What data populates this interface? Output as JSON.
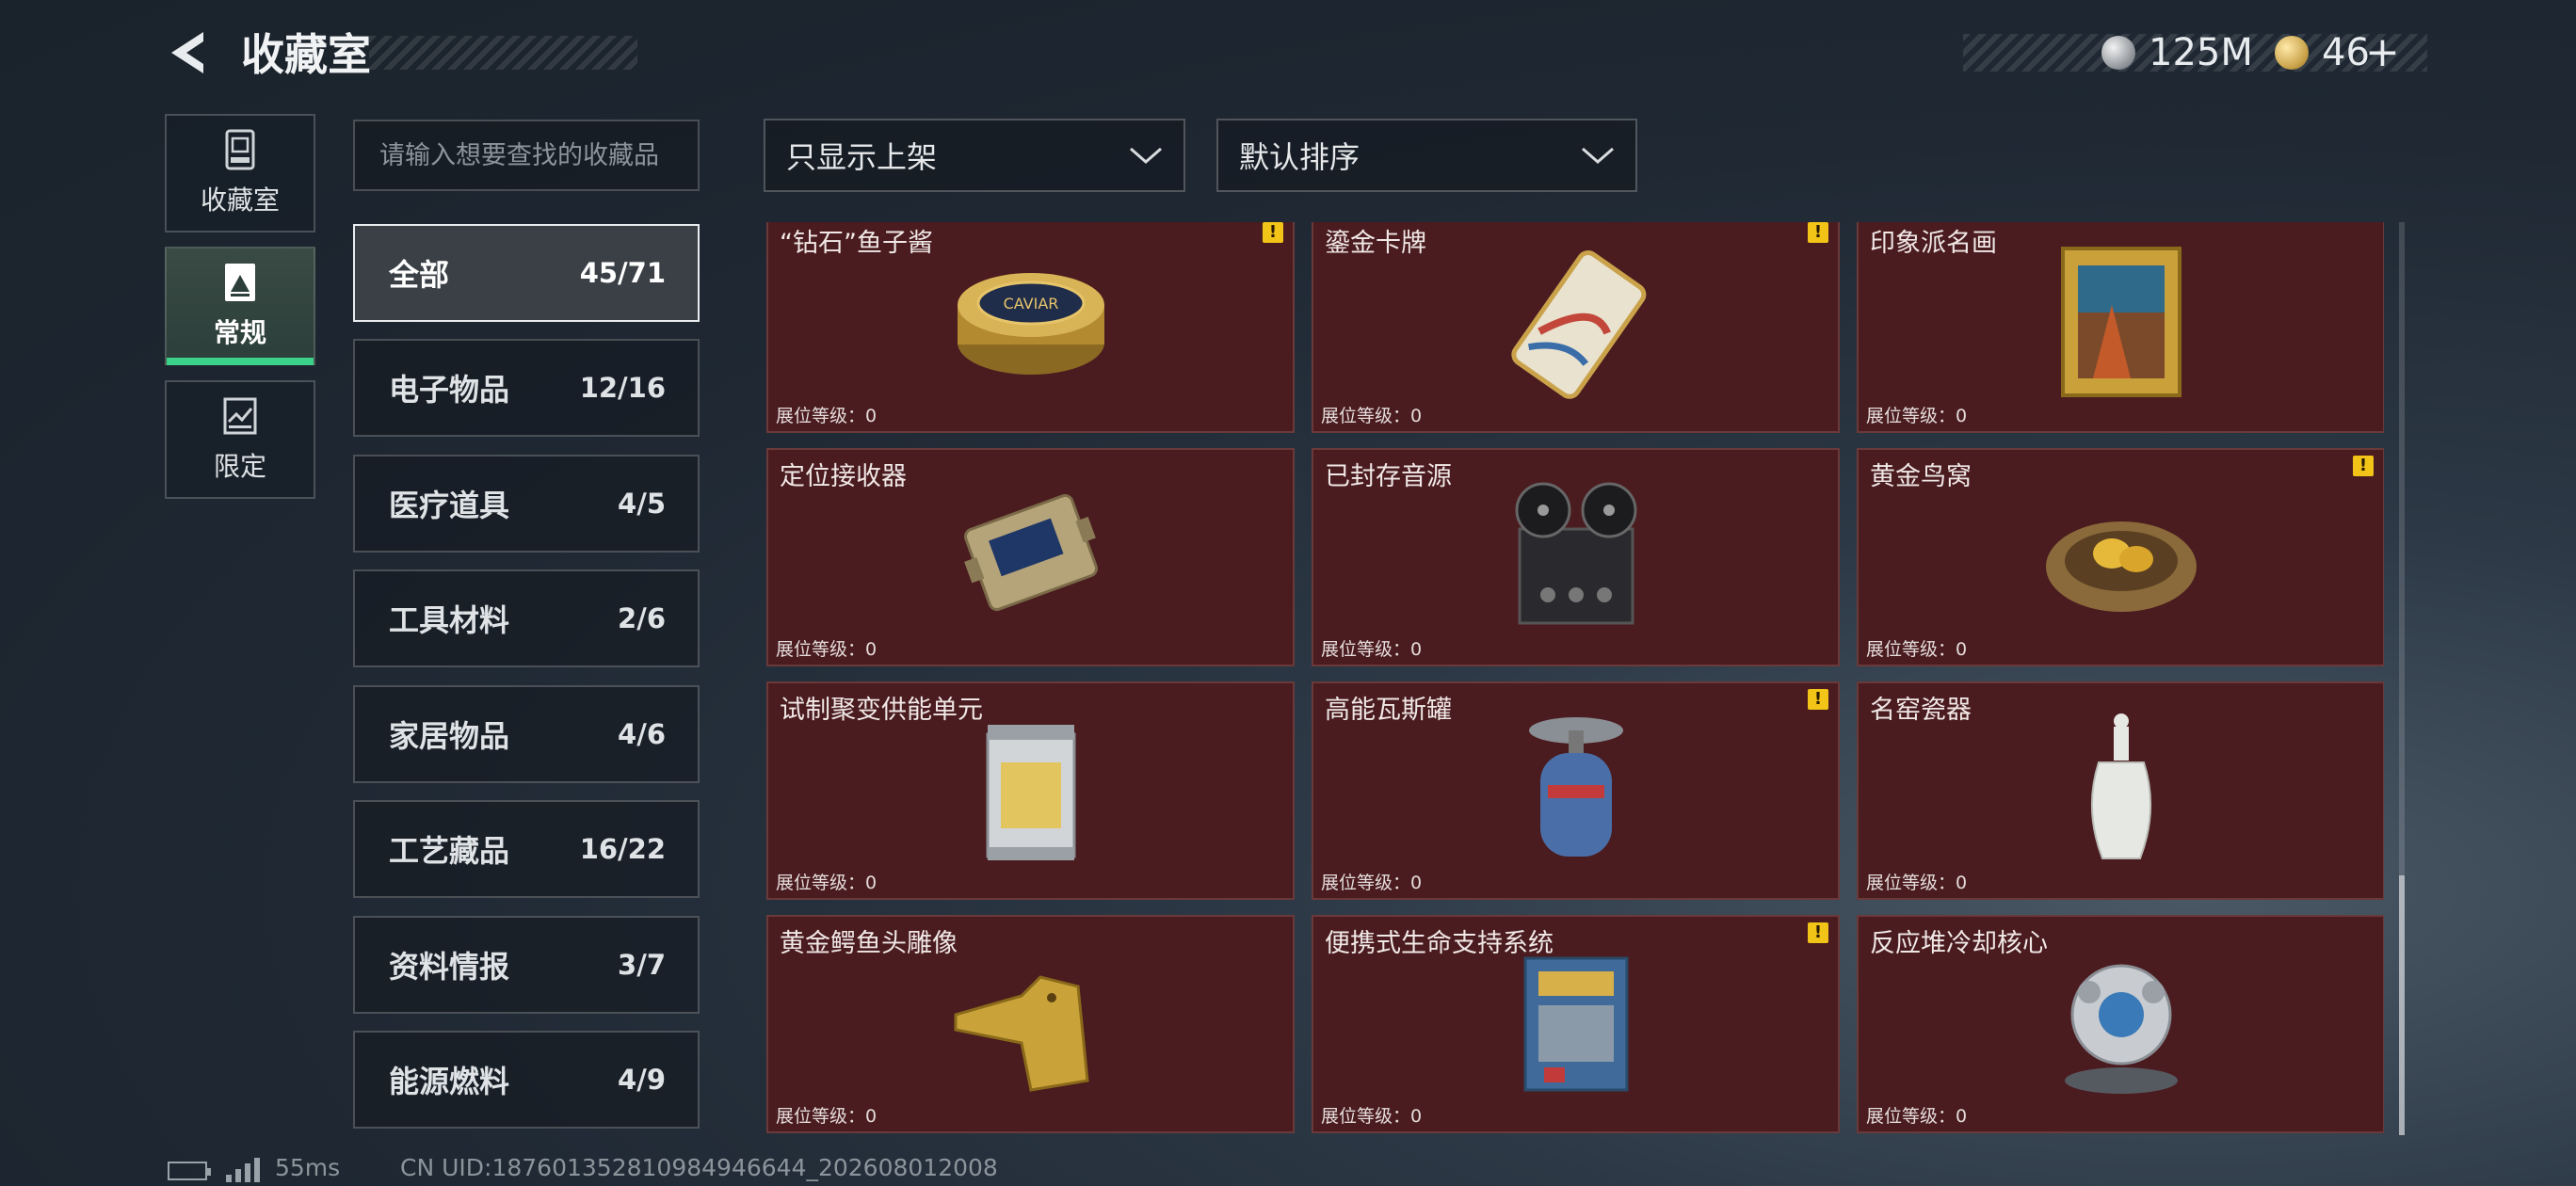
{
  "header": {
    "title": "收藏室",
    "currency_silver": "125M",
    "currency_gold": "46",
    "plus": "+"
  },
  "rail": [
    {
      "label": "收藏室",
      "icon": "vault-icon",
      "active": false
    },
    {
      "label": "常规",
      "icon": "picture-icon",
      "active": true
    },
    {
      "label": "限定",
      "icon": "limited-icon",
      "active": false
    }
  ],
  "search": {
    "placeholder": "请输入想要查找的收藏品"
  },
  "filters": {
    "display": "只显示上架",
    "sort": "默认排序"
  },
  "categories": [
    {
      "name": "全部",
      "count": "45/71"
    },
    {
      "name": "电子物品",
      "count": "12/16"
    },
    {
      "name": "医疗道具",
      "count": "4/5"
    },
    {
      "name": "工具材料",
      "count": "2/6"
    },
    {
      "name": "家居物品",
      "count": "4/6"
    },
    {
      "name": "工艺藏品",
      "count": "16/22"
    },
    {
      "name": "资料情报",
      "count": "3/7"
    },
    {
      "name": "能源燃料",
      "count": "4/9"
    }
  ],
  "items": [
    {
      "name": "“钻石”鱼子酱",
      "level": "展位等级：0",
      "warn": true
    },
    {
      "name": "鎏金卡牌",
      "level": "展位等级：0",
      "warn": true
    },
    {
      "name": "印象派名画",
      "level": "展位等级：0",
      "warn": false
    },
    {
      "name": "定位接收器",
      "level": "展位等级：0",
      "warn": false
    },
    {
      "name": "已封存音源",
      "level": "展位等级：0",
      "warn": false
    },
    {
      "name": "黄金鸟窝",
      "level": "展位等级：0",
      "warn": true
    },
    {
      "name": "试制聚变供能单元",
      "level": "展位等级：0",
      "warn": false
    },
    {
      "name": "高能瓦斯罐",
      "level": "展位等级：0",
      "warn": true
    },
    {
      "name": "名窑瓷器",
      "level": "展位等级：0",
      "warn": false
    },
    {
      "name": "黄金鳄鱼头雕像",
      "level": "展位等级：0",
      "warn": false
    },
    {
      "name": "便携式生命支持系统",
      "level": "展位等级：0",
      "warn": true
    },
    {
      "name": "反应堆冷却核心",
      "level": "展位等级：0",
      "warn": false
    }
  ],
  "warn_mark": "!",
  "caviar_label": "CAVIAR",
  "footer": {
    "ping": "55ms",
    "uid": "CN UID:187601352810984946644_202608012008"
  }
}
